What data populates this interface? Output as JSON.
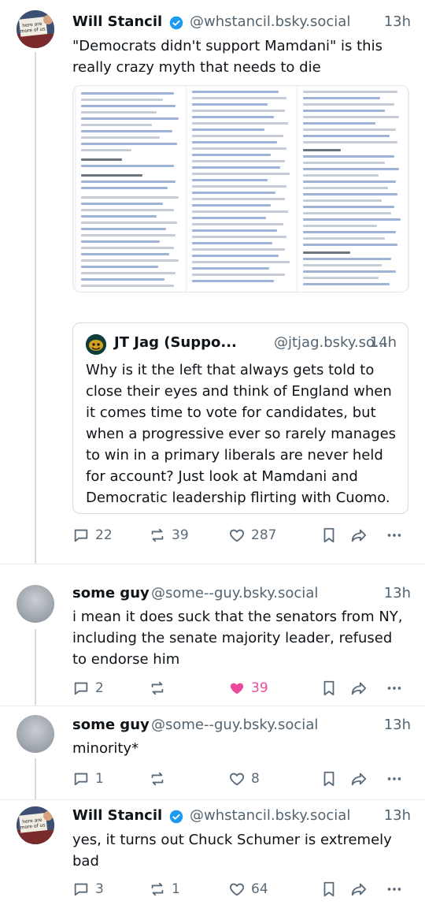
{
  "posts": [
    {
      "name": "Will Stancil",
      "handle": "@whstancil.bsky.social",
      "time": "13h",
      "text": "\"Democrats didn't support Mamdani\" is this really crazy myth that needs to die",
      "avatar": "avatar-will",
      "avatar_sign": "\"here are more of us than them\"",
      "verified": true,
      "actions": {
        "replies": "22",
        "reposts": "39",
        "likes": "287",
        "liked": false
      },
      "quote": {
        "name": "JT Jag (Suppo...",
        "handle": "@jtjag.bsky.so...",
        "time": "14h",
        "text": "Why is it the left that always gets told to close their eyes and think of England when it comes time to vote for candidates, but when a progressive ever so rarely manages to win in a primary liberals are never held for account? Just look at Mamdani and Democratic leadership flirting with Cuomo."
      }
    },
    {
      "name": "some guy",
      "handle": "@some--guy.bsky.social",
      "time": "13h",
      "text": "i mean it does suck that the senators from NY, including the senate majority leader, refused to endorse him",
      "avatar": "avatar-guy",
      "actions": {
        "replies": "2",
        "reposts": "",
        "likes": "39",
        "liked": true
      }
    },
    {
      "name": "some guy",
      "handle": "@some--guy.bsky.social",
      "time": "13h",
      "text": "minority*",
      "avatar": "avatar-guy",
      "actions": {
        "replies": "1",
        "reposts": "",
        "likes": "8",
        "liked": false
      }
    },
    {
      "name": "Will Stancil",
      "handle": "@whstancil.bsky.social",
      "time": "13h",
      "text": "yes, it turns out Chuck Schumer is extremely bad",
      "avatar": "avatar-will",
      "avatar_sign": "\"here are more of us than them\"",
      "verified": true,
      "actions": {
        "replies": "3",
        "reposts": "1",
        "likes": "64",
        "liked": false
      }
    }
  ],
  "colors": {
    "text": "#0f1419",
    "muted": "#536471",
    "link": "#2a62c9",
    "like": "#ec4899",
    "verified": "#1d9bf0"
  }
}
